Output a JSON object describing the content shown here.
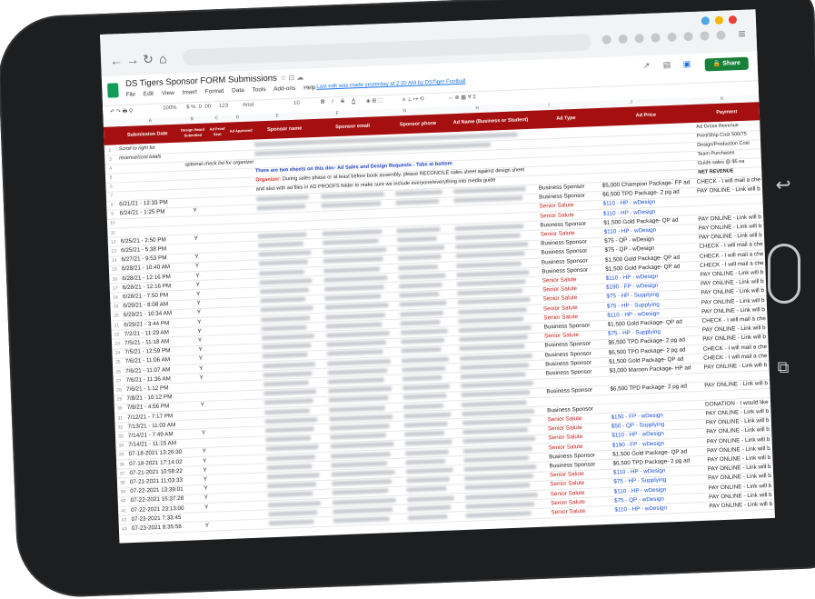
{
  "sheet": {
    "title": "DS Tigers Sponsor FORM Submissions",
    "menu": [
      "File",
      "Edit",
      "View",
      "Insert",
      "Format",
      "Data",
      "Tools",
      "Add-ons",
      "Help"
    ],
    "last_edit": "Last edit was made yesterday at 2:20 AM by DSTiger Football",
    "share_label": "Share",
    "zoom": "100%",
    "font": "Arial",
    "font_size": "10",
    "format_number": "123",
    "columns": [
      "A",
      "B",
      "C",
      "D",
      "E",
      "F",
      "G",
      "H",
      "I",
      "J",
      "K"
    ]
  },
  "header_row": {
    "submission_date": "Submission Date",
    "design_heard": "Design Heard Submitted",
    "ad_proof_sent": "Ad Proof Sent",
    "ad_approved": "Ad Approved",
    "sponsor_name": "Sponsor name",
    "sponsor_email": "Sponsor email",
    "sponsor_phone": "Sponsor phone",
    "ad_name": "Ad Name (Business or Student)",
    "ad_type": "Ad Type",
    "ad_price": "Ad Price",
    "payment": "Payment"
  },
  "notes": {
    "scroll_note_1": "Scroll to right for",
    "scroll_note_2": "revenue/cost totals",
    "check_note": "optional check list for organizer",
    "two_sheets": "There are two sheets on this doc- Ad Sales and Design Requests - Tabs at bottom",
    "organizer_label": "Organizer:",
    "organizer_text": " During sales phase or at least before book assembly, please RECONCILE sales sheet against design sheet",
    "organizer_text2": "and also with ad files in AD PROOFS folder to make sure we include everyone/everything into media guide"
  },
  "right_panel": {
    "gross": "Ad Gross Revenue",
    "print": "Print/Ship Cost 500/75",
    "design": "Design/Production Cost",
    "team": "Team Purchases",
    "guide": "Guide sales @ $5 ea",
    "net": "NET REVENUE"
  },
  "rows": [
    {
      "n": "8",
      "date": "6/21/21 - 12:33 PM",
      "y": "",
      "type": "Business Sponsor",
      "price": "$5,000 Champion Package- FP ad",
      "pay": "CHECK - I will mail a che"
    },
    {
      "n": "9",
      "date": "6/24/21 - 1:25 PM",
      "y": "Y",
      "type": "Business Sponsor",
      "price": "$6,500 TPD Package- 2 pg ad",
      "pay": "PAY ONLINE - Link will b"
    },
    {
      "n": "10",
      "date": "",
      "y": "",
      "type": "Senior Salute",
      "price": "$110 - HP - wDesign",
      "pay": ""
    },
    {
      "n": "11",
      "date": "",
      "y": "",
      "type": "Senior Salute",
      "price": "$110 - HP - wDesign",
      "pay": ""
    },
    {
      "n": "12",
      "date": "6/25/21 - 2:50 PM",
      "y": "Y",
      "type": "Business Sponsor",
      "price": "$1,500 Gold Package- QP ad",
      "pay": "PAY ONLINE - Link will b"
    },
    {
      "n": "13",
      "date": "6/25/21 - 5:38 PM",
      "y": "",
      "type": "Senior Salute",
      "price": "$110 - HP - wDesign",
      "pay": "PAY ONLINE - Link will b"
    },
    {
      "n": "14",
      "date": "6/27/21 - 9:53 PM",
      "y": "Y",
      "type": "Business Sponsor",
      "price": "$75 - QP - wDesign",
      "pay": "PAY ONLINE - Link will b"
    },
    {
      "n": "15",
      "date": "6/28/21 - 10:40 AM",
      "y": "Y",
      "type": "Business Sponsor",
      "price": "$75 - QP - wDesign",
      "pay": "CHECK - I will mail a che"
    },
    {
      "n": "16",
      "date": "6/28/21 - 12:16 PM",
      "y": "Y",
      "type": "Business Sponsor",
      "price": "$1,500 Gold Package- QP ad",
      "pay": "CHECK - I will mail a che"
    },
    {
      "n": "17",
      "date": "6/28/21 - 12:16 PM",
      "y": "Y",
      "type": "Business Sponsor",
      "price": "$1,500 Gold Package- QP ad",
      "pay": "CHECK - I will mail a che"
    },
    {
      "n": "18",
      "date": "6/28/21 - 7:50 PM",
      "y": "Y",
      "type": "Senior Salute",
      "price": "$110 - HP - wDesign",
      "pay": "PAY ONLINE - Link will b"
    },
    {
      "n": "19",
      "date": "6/29/21 - 8:08 AM",
      "y": "Y",
      "type": "Senior Salute",
      "price": "$190 - FP - wDesign",
      "pay": "PAY ONLINE - Link will b"
    },
    {
      "n": "20",
      "date": "6/29/21 - 10:34 AM",
      "y": "Y",
      "type": "Senior Salute",
      "price": "$75 - HP - Supplying",
      "pay": "PAY ONLINE - Link will b"
    },
    {
      "n": "21",
      "date": "6/29/21 - 3:44 PM",
      "y": "Y",
      "type": "Senior Salute",
      "price": "$75 - HP - Supplying",
      "pay": "PAY ONLINE - Link will b"
    },
    {
      "n": "22",
      "date": "7/2/21 - 11:29 AM",
      "y": "Y",
      "type": "Senior Salute",
      "price": "$110 - HP - wDesign",
      "pay": "PAY ONLINE - Link will b"
    },
    {
      "n": "23",
      "date": "7/5/21 - 11:18 AM",
      "y": "Y",
      "type": "Business Sponsor",
      "price": "$1,500 Gold Package- QP ad",
      "pay": "CHECK - I will mail a che"
    },
    {
      "n": "24",
      "date": "7/5/21 - 12:59 PM",
      "y": "Y",
      "type": "Senior Salute",
      "price": "$75 - HP - Supplying",
      "pay": "PAY ONLINE - Link will b"
    },
    {
      "n": "25",
      "date": "7/6/21 - 11:06 AM",
      "y": "Y",
      "type": "Business Sponsor",
      "price": "$6,500 TPD Package- 2 pg ad",
      "pay": "PAY ONLINE - Link will b"
    },
    {
      "n": "26",
      "date": "7/6/21 - 11:07 AM",
      "y": "Y",
      "type": "Business Sponsor",
      "price": "$6,500 TPD Package- 2 pg ad",
      "pay": "CHECK - I will mail a che"
    },
    {
      "n": "27",
      "date": "7/6/21 - 11:36 AM",
      "y": "Y",
      "type": "Business Sponsor",
      "price": "$1,500 Gold Package- QP ad",
      "pay": "CHECK - I will mail a che"
    },
    {
      "n": "28",
      "date": "7/6/21 - 1:12 PM",
      "y": "",
      "type": "Business Sponsor",
      "price": "$3,000 Maroon Package- HP ad",
      "pay": "PAY ONLINE - Link will b"
    },
    {
      "n": "29",
      "date": "7/8/21 - 10:12 PM",
      "y": "",
      "type": "",
      "price": "",
      "pay": ""
    },
    {
      "n": "30",
      "date": "7/8/21 - 4:56 PM",
      "y": "Y",
      "type": "Business Sponsor",
      "price": "$6,500 TPD Package- 2 pg ad",
      "pay": "PAY ONLINE - Link will b"
    },
    {
      "n": "31",
      "date": "7/12/21 - 7:17 PM",
      "y": "",
      "type": "",
      "price": "",
      "pay": ""
    },
    {
      "n": "32",
      "date": "7/13/21 - 11:03 AM",
      "y": "",
      "type": "Business Sponsor",
      "price": "",
      "pay": "DONATION - I would like"
    },
    {
      "n": "33",
      "date": "7/14/21 - 7:49 AM",
      "y": "Y",
      "type": "Senior Salute",
      "price": "$150 - FP - wDesign",
      "pay": "PAY ONLINE - Link will b"
    },
    {
      "n": "34",
      "date": "7/14/21 - 11:15 AM",
      "y": "",
      "type": "Senior Salute",
      "price": "$50 - QP - Supplying",
      "pay": "PAY ONLINE - Link will b"
    },
    {
      "n": "35",
      "date": "07-18-2021 13:26:30",
      "y": "Y",
      "type": "Senior Salute",
      "price": "$110 - HP - wDesign",
      "pay": "PAY ONLINE - Link will b"
    },
    {
      "n": "36",
      "date": "07-18-2021 17:14:02",
      "y": "Y",
      "type": "Senior Salute",
      "price": "$190 - FP - wDesign",
      "pay": "PAY ONLINE - Link will b"
    },
    {
      "n": "37",
      "date": "07-21-2021 10:58:22",
      "y": "Y",
      "type": "Business Sponsor",
      "price": "$1,500 Gold Package- QP ad",
      "pay": "PAY ONLINE - Link will b"
    },
    {
      "n": "38",
      "date": "07-21-2021 11:03:33",
      "y": "Y",
      "type": "Business Sponsor",
      "price": "$6,500 TPD Package- 2 pg ad",
      "pay": "PAY ONLINE - Link will b"
    },
    {
      "n": "39",
      "date": "07-22-2021 13:39:01",
      "y": "Y",
      "type": "Senior Salute",
      "price": "$110 - HP - wDesign",
      "pay": "PAY ONLINE - Link will b"
    },
    {
      "n": "40",
      "date": "07-22-2021 16:37:28",
      "y": "Y",
      "type": "Senior Salute",
      "price": "$75 - HP - Supplying",
      "pay": "PAY ONLINE - Link will b"
    },
    {
      "n": "41",
      "date": "07-22-2021 23:13:00",
      "y": "Y",
      "type": "Senior Salute",
      "price": "$110 - HP - wDesign",
      "pay": "PAY ONLINE - Link will b"
    },
    {
      "n": "42",
      "date": "07-23-2021 7:33:45",
      "y": "",
      "type": "Senior Salute",
      "price": "$75 - QP - wDesign",
      "pay": "PAY ONLINE - Link will b"
    },
    {
      "n": "43",
      "date": "07-23-2021 8:35:58",
      "y": "Y",
      "type": "Senior Salute",
      "price": "$110 - HP - wDesign",
      "pay": "PAY ONLINE - Link will b"
    }
  ],
  "colors": {
    "header": "#a50f0f",
    "share": "#188038",
    "senior": "#c5221f",
    "price_blue": "#1a4fd6"
  }
}
